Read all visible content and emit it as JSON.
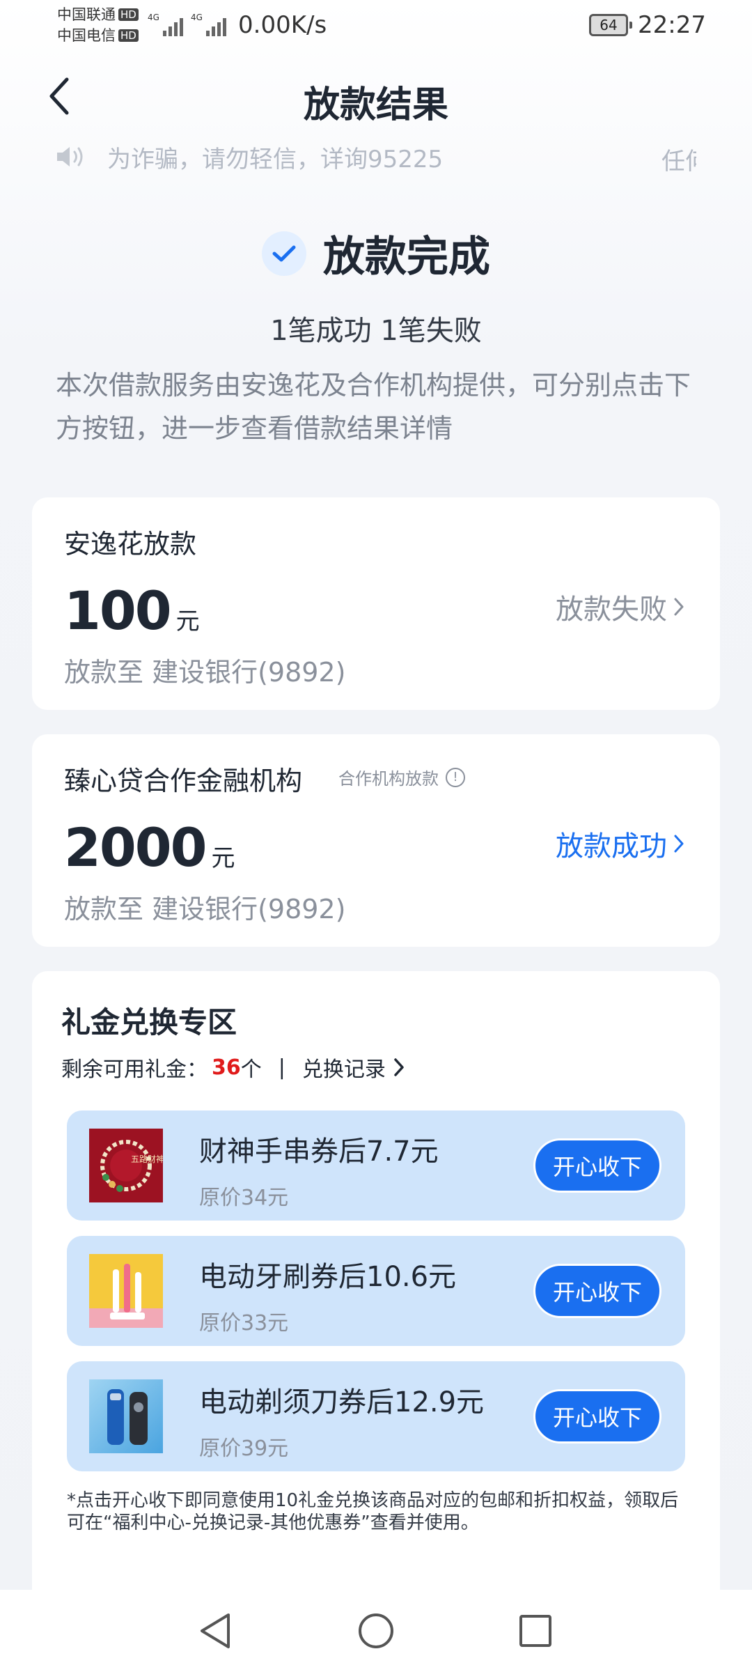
{
  "status_bar": {
    "carrier1": "中国联通",
    "carrier2": "中国电信",
    "hd_label": "HD",
    "signal_label": "4G",
    "net_speed": "0.00K/s",
    "battery": "64",
    "time": "22:27"
  },
  "header": {
    "title": "放款结果"
  },
  "notice": {
    "text": "为诈骗，请勿轻信，详询95225",
    "tail": "任何"
  },
  "result": {
    "title": "放款完成",
    "count": "1笔成功 1笔失败",
    "description": "本次借款服务由安逸花及合作机构提供，可分别点击下方按钮，进一步查看借款结果详情"
  },
  "loans": [
    {
      "lender": "安逸花放款",
      "amount": "100",
      "unit": "元",
      "status": "放款失败",
      "destination": "放款至 建设银行(9892)"
    },
    {
      "lender": "臻心贷合作金融机构",
      "tag": "合作机构放款",
      "amount": "2000",
      "unit": "元",
      "status": "放款成功",
      "destination": "放款至 建设银行(9892)"
    }
  ],
  "gift": {
    "title": "礼金兑换专区",
    "remaining_label": "剩余可用礼金：",
    "remaining_count": "36",
    "remaining_unit": "个",
    "separator": "|",
    "record_link": "兑换记录",
    "offers": [
      {
        "name": "财神手串券后7.7元",
        "original": "原价34元",
        "button": "开心收下",
        "image_text": "五路财神"
      },
      {
        "name": "电动牙刷券后10.6元",
        "original": "原价33元",
        "button": "开心收下"
      },
      {
        "name": "电动剃须刀券后12.9元",
        "original": "原价39元",
        "button": "开心收下"
      }
    ],
    "note": "*点击开心收下即同意使用10礼金兑换该商品对应的包邮和折扣权益，领取后可在“福利中心-兑换记录-其他优惠券”查看并使用。"
  },
  "colors": {
    "accent": "#1a6ff0",
    "highlight": "#e01b1b",
    "offer_bg": "#cfe4fb"
  }
}
